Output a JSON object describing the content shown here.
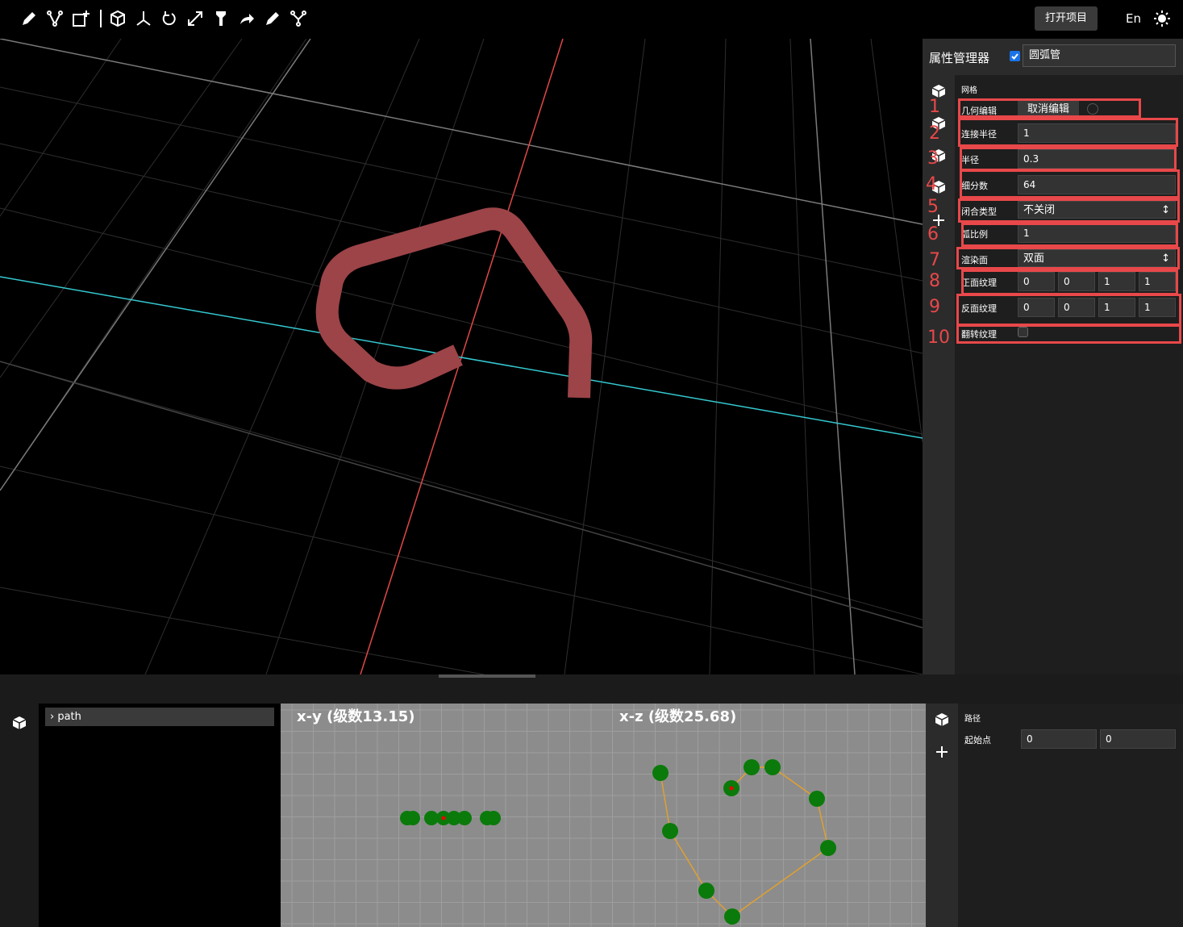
{
  "toolbar": {
    "tools": [
      "pencil-icon",
      "vertex-edit-icon",
      "add-object-icon",
      "cube-icon",
      "axes-icon",
      "rotate-icon",
      "scale-icon",
      "flashlight-icon",
      "redo-arrow-icon",
      "brush-icon",
      "branch-icon"
    ],
    "open_project": "打开项目",
    "language": "En"
  },
  "property_panel": {
    "title": "属性管理器",
    "object_name": "圆弧管",
    "section": "网格",
    "geometry_edit_label": "几何编辑",
    "geometry_edit_button": "取消编辑",
    "fields": [
      {
        "num": "1",
        "label": "连接半径",
        "value": "1"
      },
      {
        "num": "3",
        "label": "半径",
        "value": "0.3"
      },
      {
        "num": "4",
        "label": "细分数",
        "value": "64"
      },
      {
        "num": "5",
        "label": "闭合类型",
        "value": "不关闭"
      },
      {
        "num": "6",
        "label": "弧比例",
        "value": "1"
      },
      {
        "num": "7",
        "label": "渲染面",
        "value": "双面"
      }
    ],
    "front_texture": {
      "label": "正面纹理",
      "values": [
        "0",
        "0",
        "1",
        "1"
      ]
    },
    "back_texture": {
      "label": "反面纹理",
      "values": [
        "0",
        "0",
        "1",
        "1"
      ]
    },
    "flip_texture": {
      "label": "翻转纹理",
      "checked": false
    },
    "annotation_numbers": [
      "1",
      "2",
      "3",
      "4",
      "5",
      "6",
      "7",
      "8",
      "9",
      "10"
    ]
  },
  "tree": {
    "item": "path"
  },
  "graph": {
    "xy_title": "x-y (级数13.15)",
    "xz_title": "x-z (级数25.68)"
  },
  "path_panel": {
    "section": "路径",
    "start_label": "起始点",
    "start_values": [
      "0",
      "0"
    ]
  },
  "colors": {
    "accent_red": "#e8484a",
    "tube": "#9c4448",
    "point_green": "#0a7a0a",
    "path_orange": "#e0a030",
    "axis_cyan": "#35c8d0",
    "axis_red": "#e04848"
  }
}
